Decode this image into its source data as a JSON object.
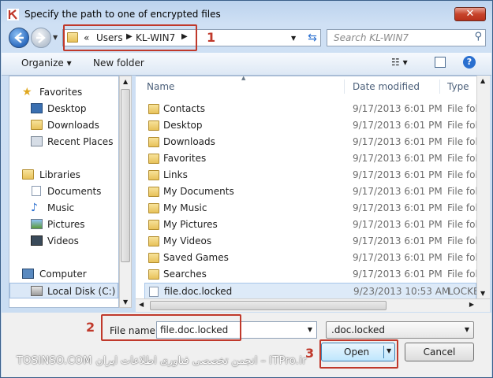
{
  "window": {
    "title": "Specify the path to one of encrypted files",
    "close_label": "✕"
  },
  "address": {
    "chevron": "«",
    "crumbs": [
      "Users",
      "KL-WIN7"
    ]
  },
  "search": {
    "placeholder": "Search KL-WIN7"
  },
  "toolbar": {
    "organize": "Organize ▾",
    "new_folder": "New folder"
  },
  "nav": {
    "items": [
      {
        "label": "Favorites",
        "icon": "star-icon"
      },
      {
        "label": "Desktop",
        "icon": "desktop-icon"
      },
      {
        "label": "Downloads",
        "icon": "downloads-folder-icon"
      },
      {
        "label": "Recent Places",
        "icon": "recent-places-icon"
      },
      {
        "label": "Libraries",
        "icon": "libraries-icon"
      },
      {
        "label": "Documents",
        "icon": "documents-icon"
      },
      {
        "label": "Music",
        "icon": "music-icon"
      },
      {
        "label": "Pictures",
        "icon": "pictures-icon"
      },
      {
        "label": "Videos",
        "icon": "videos-icon"
      },
      {
        "label": "Computer",
        "icon": "computer-icon"
      },
      {
        "label": "Local Disk (C:)",
        "icon": "drive-icon"
      }
    ]
  },
  "list": {
    "columns": [
      "Name",
      "Date modified",
      "Type"
    ],
    "rows": [
      {
        "name": "Contacts",
        "date": "9/17/2013 6:01 PM",
        "type": "File fol"
      },
      {
        "name": "Desktop",
        "date": "9/17/2013 6:01 PM",
        "type": "File fol"
      },
      {
        "name": "Downloads",
        "date": "9/17/2013 6:01 PM",
        "type": "File fol"
      },
      {
        "name": "Favorites",
        "date": "9/17/2013 6:01 PM",
        "type": "File fol"
      },
      {
        "name": "Links",
        "date": "9/17/2013 6:01 PM",
        "type": "File fol"
      },
      {
        "name": "My Documents",
        "date": "9/17/2013 6:01 PM",
        "type": "File fol"
      },
      {
        "name": "My Music",
        "date": "9/17/2013 6:01 PM",
        "type": "File fol"
      },
      {
        "name": "My Pictures",
        "date": "9/17/2013 6:01 PM",
        "type": "File fol"
      },
      {
        "name": "My Videos",
        "date": "9/17/2013 6:01 PM",
        "type": "File fol"
      },
      {
        "name": "Saved Games",
        "date": "9/17/2013 6:01 PM",
        "type": "File fol"
      },
      {
        "name": "Searches",
        "date": "9/17/2013 6:01 PM",
        "type": "File fol"
      },
      {
        "name": "file.doc.locked",
        "date": "9/23/2013 10:53 AM",
        "type": "LOCKE"
      }
    ]
  },
  "bottom": {
    "filename_label": "File name:",
    "filename_value": "file.doc.locked",
    "filter_value": ".doc.locked",
    "open_label": "Open",
    "cancel_label": "Cancel"
  },
  "annotations": {
    "one": "1",
    "two": "2",
    "three": "3",
    "color": "#c0392b"
  },
  "watermark": "TOSINSO.COM انجمن تخصصی فناوری اطلاعات ایران – ITPro.ir"
}
